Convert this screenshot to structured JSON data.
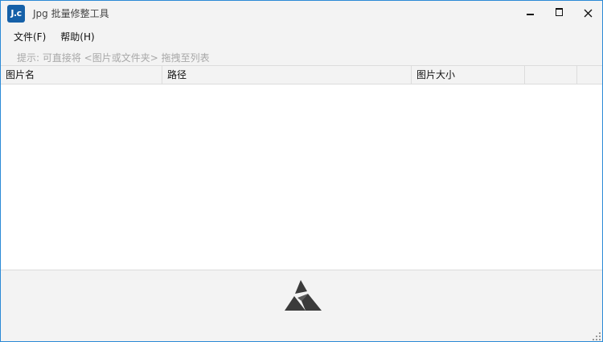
{
  "window": {
    "title": "Jpg 批量修整工具",
    "icon_text": "J.c",
    "accent_color": "#2b8ad6",
    "icon_color": "#1560a8"
  },
  "window_controls": {
    "minimize_icon": "minimize-icon",
    "maximize_icon": "maximize-icon",
    "close_glyph": "✕"
  },
  "menu": {
    "items": [
      {
        "label": "文件(F)"
      },
      {
        "label": "帮助(H)"
      }
    ]
  },
  "hint": {
    "text": "提示: 可直接将 <图片或文件夹> 拖拽至列表"
  },
  "table": {
    "columns": [
      {
        "label": "图片名"
      },
      {
        "label": "路径"
      },
      {
        "label": "图片大小"
      },
      {
        "label": ""
      },
      {
        "label": ""
      }
    ],
    "rows": []
  },
  "bottom": {
    "logo_icon": "triangle-logo-icon",
    "grip_icon": "resize-grip-icon"
  }
}
